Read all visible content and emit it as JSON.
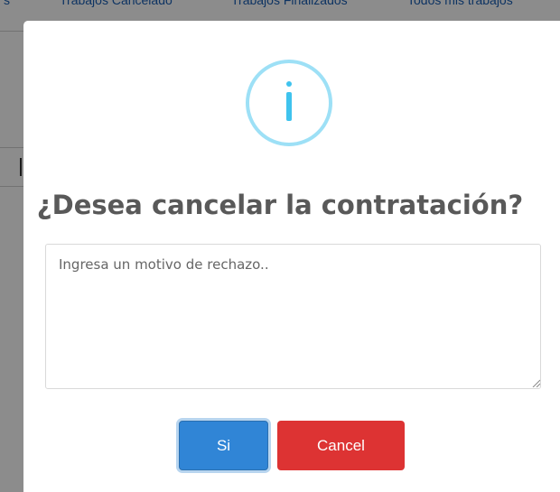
{
  "background": {
    "tabs": [
      "s",
      "Trabajos Cancelado",
      "Trabajos Finalizados",
      "Todos mis trabajos"
    ]
  },
  "modal": {
    "icon": "info-icon",
    "icon_color": "#3fc3ee",
    "icon_ring_color": "#9de0f6",
    "title": "¿Desea cancelar la contratación?",
    "reason_input": {
      "placeholder": "Ingresa un motivo de rechazo..",
      "value": ""
    },
    "confirm_label": "Si",
    "cancel_label": "Cancel",
    "confirm_color": "#3085d6",
    "cancel_color": "#dd3333"
  }
}
